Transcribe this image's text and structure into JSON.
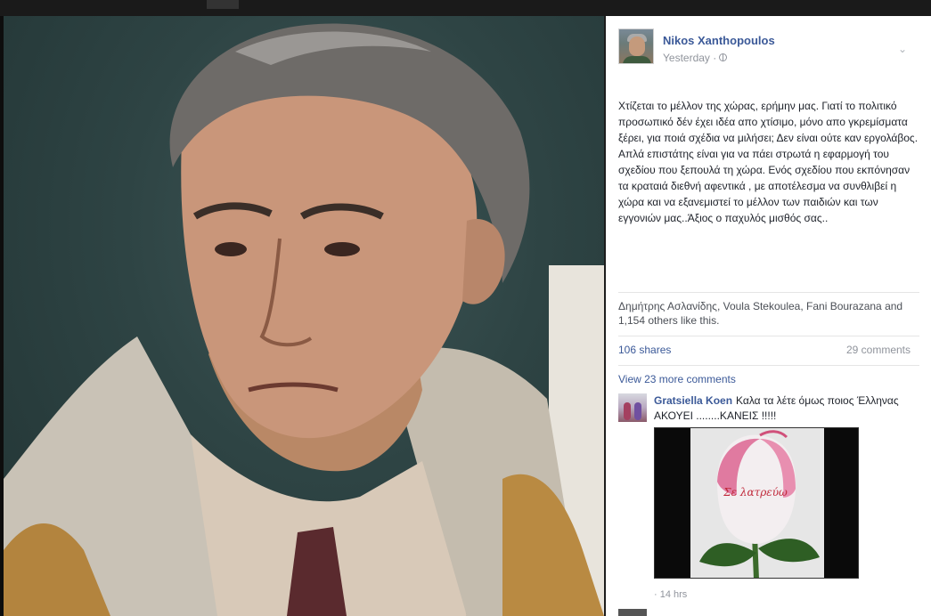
{
  "post": {
    "author": "Nikos Xanthopoulos",
    "timestamp": "Yesterday ·",
    "text": "Χτίζεται το μέλλον της χώρας, ερήμην μας. Γιατί το πολιτικό προσωπικό δέν έχει ιδέα απο χτίσιμο, μόνο απο γκρεμίσματα ξέρει, για ποιά σχέδια να μιλήσει; Δεν είναι ούτε καν εργολάβος. Απλά επιστάτης είναι για να πάει στρωτά η εφαρμογή του σχεδίου που ξεπουλά τη χώρα. Ενός σχεδίου που εκπόνησαν τα κραταιά διεθνή αφεντικά , με αποτέλεσμα να συνθλιβεί η χώρα και να εξανεμιστεί το μέλλον των παιδιών και των εγγονιών μας..Άξιος ο παχυλός μισθός σας..",
    "likes": "Δημήτρης Ασλανίδης, Voula Stekoulea, Fani Bourazana and 1,154 others like this.",
    "shares": "106 shares",
    "comments_count": "29 comments",
    "view_more": "View 23 more comments"
  },
  "comment": {
    "author": "Gratsiella Koen",
    "text": "Καλα τα λέτε όμως ποιος Έλληνας ΑΚΟΥΕΙ ........ΚΑΝΕΙΣ !!!!!",
    "image_text": "Σε λατρεύω",
    "time": "· 14 hrs"
  },
  "icons": {
    "privacy": "globe-icon",
    "options": "chevron-down-icon"
  },
  "colors": {
    "link": "#3b5998",
    "meta": "#90949c"
  }
}
